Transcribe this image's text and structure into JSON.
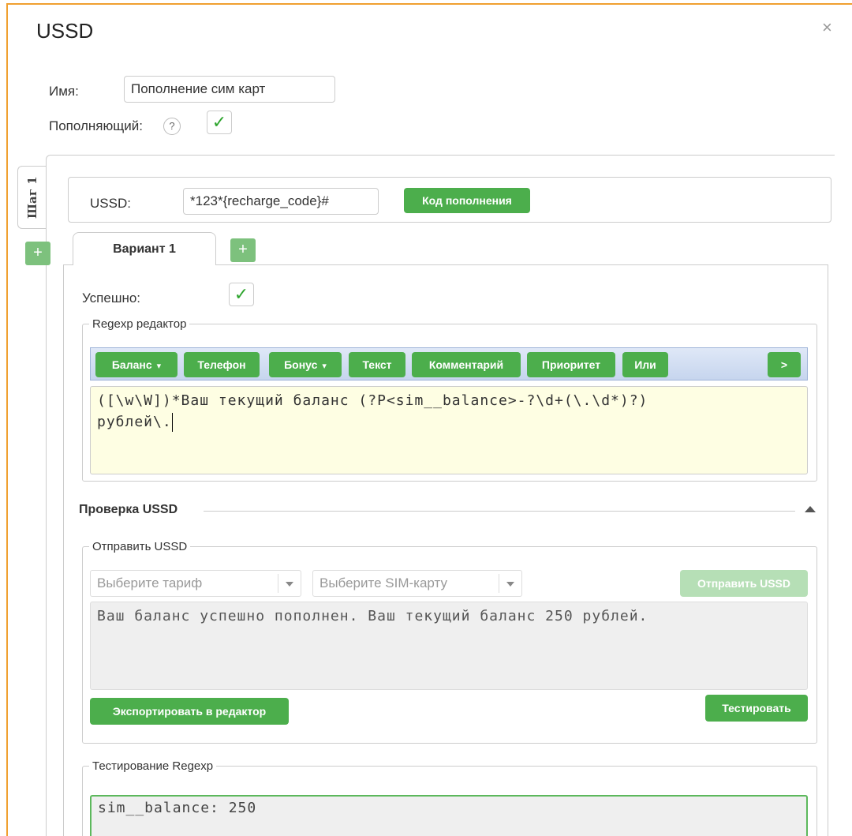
{
  "dialog": {
    "title": "USSD",
    "close": "×"
  },
  "form": {
    "name_label": "Имя:",
    "name_value": "Пополнение сим карт",
    "recharger_label": "Пополняющий:",
    "help": "?",
    "check": "✓"
  },
  "steps": {
    "tab_label": "Шаг 1",
    "add": "+"
  },
  "ussd": {
    "label": "USSD:",
    "value": "*123*{recharge_code}#",
    "code_button": "Код пополнения"
  },
  "variants": {
    "tab_label": "Вариант 1",
    "add": "+"
  },
  "variant": {
    "success_label": "Успешно:",
    "success_check": "✓",
    "regexp_legend": "Regexp редактор",
    "toolbar": {
      "balance": "Баланс",
      "phone": "Телефон",
      "bonus": "Бонус",
      "text": "Текст",
      "comment": "Комментарий",
      "priority": "Приоритет",
      "or": "Или",
      "more": ">",
      "caret": "▾"
    },
    "regexp_line1": "([\\w\\W])*Ваш текущий баланс (?P<sim__balance>-?\\d+(\\.\\d*)?)",
    "regexp_line2": "рублей\\."
  },
  "check_section": {
    "title": "Проверка USSD",
    "send_legend": "Отправить USSD",
    "tariff_placeholder": "Выберите тариф",
    "sim_placeholder": "Выберите SIM-карту",
    "send_button": "Отправить USSD",
    "response_text": "Ваш баланс успешно пополнен. Ваш текущий баланс 250 рублей.",
    "export_button": "Экспортировать в редактор",
    "test_button": "Тестировать",
    "test_legend": "Тестирование Regexp",
    "test_result": "sim__balance: 250"
  },
  "colors": {
    "accent_green": "#4cae4c",
    "window_border": "#f0a030",
    "editor_bg": "#fefee3"
  }
}
